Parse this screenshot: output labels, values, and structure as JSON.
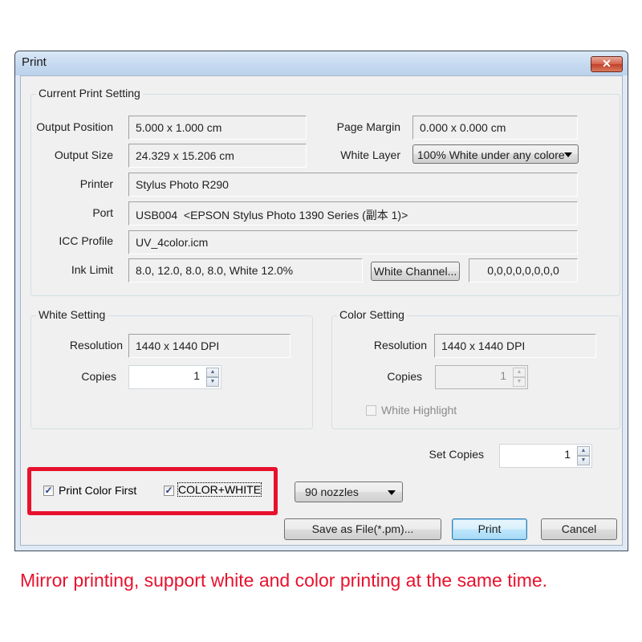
{
  "window": {
    "title": "Print",
    "close_icon": "close-x-icon",
    "close_glyph": "✕"
  },
  "current_print_setting": {
    "group_label": "Current Print Setting",
    "output_position": {
      "label": "Output Position",
      "value": "5.000 x 1.000 cm"
    },
    "output_size": {
      "label": "Output Size",
      "value": "24.329 x 15.206 cm"
    },
    "page_margin": {
      "label": "Page Margin",
      "value": "0.000 x 0.000 cm"
    },
    "white_layer": {
      "label": "White Layer",
      "selected": "100% White under any colore"
    },
    "printer": {
      "label": "Printer",
      "value": "Stylus Photo R290"
    },
    "port": {
      "label": "Port",
      "value": "USB004  <EPSON Stylus Photo 1390 Series (副本 1)>"
    },
    "icc_profile": {
      "label": "ICC Profile",
      "value": "UV_4color.icm"
    },
    "ink_limit": {
      "label": "Ink Limit",
      "value": "8.0, 12.0, 8.0, 8.0, White 12.0%"
    },
    "white_channel_button": "White Channel...",
    "white_channel_value": "0,0,0,0,0,0,0,0"
  },
  "white_setting": {
    "group_label": "White Setting",
    "resolution": {
      "label": "Resolution",
      "value": "1440 x 1440 DPI"
    },
    "copies": {
      "label": "Copies",
      "value": "1"
    }
  },
  "color_setting": {
    "group_label": "Color Setting",
    "resolution": {
      "label": "Resolution",
      "value": "1440 x 1440 DPI"
    },
    "copies": {
      "label": "Copies",
      "value": "1",
      "disabled": true
    },
    "white_highlight": {
      "label": "White Highlight",
      "checked": false,
      "disabled": true
    }
  },
  "set_copies": {
    "label": "Set Copies",
    "value": "1"
  },
  "options": {
    "print_color_first": {
      "label": "Print Color First",
      "checked": true
    },
    "color_white": {
      "label": "COLOR+WHITE",
      "checked": true
    }
  },
  "nozzles": {
    "selected": "90 nozzles"
  },
  "buttons": {
    "save_as_file": "Save as File(*.pm)...",
    "print": "Print",
    "cancel": "Cancel"
  },
  "glyphs": {
    "check": "✓",
    "spin_up": "▲",
    "spin_down": "▼"
  },
  "caption": "Mirror printing, support white and color printing at the same time.",
  "colors": {
    "highlight_red": "#e8112d",
    "titlebar": "#c4d8ef",
    "dialog_bg": "#f0f0f0"
  }
}
